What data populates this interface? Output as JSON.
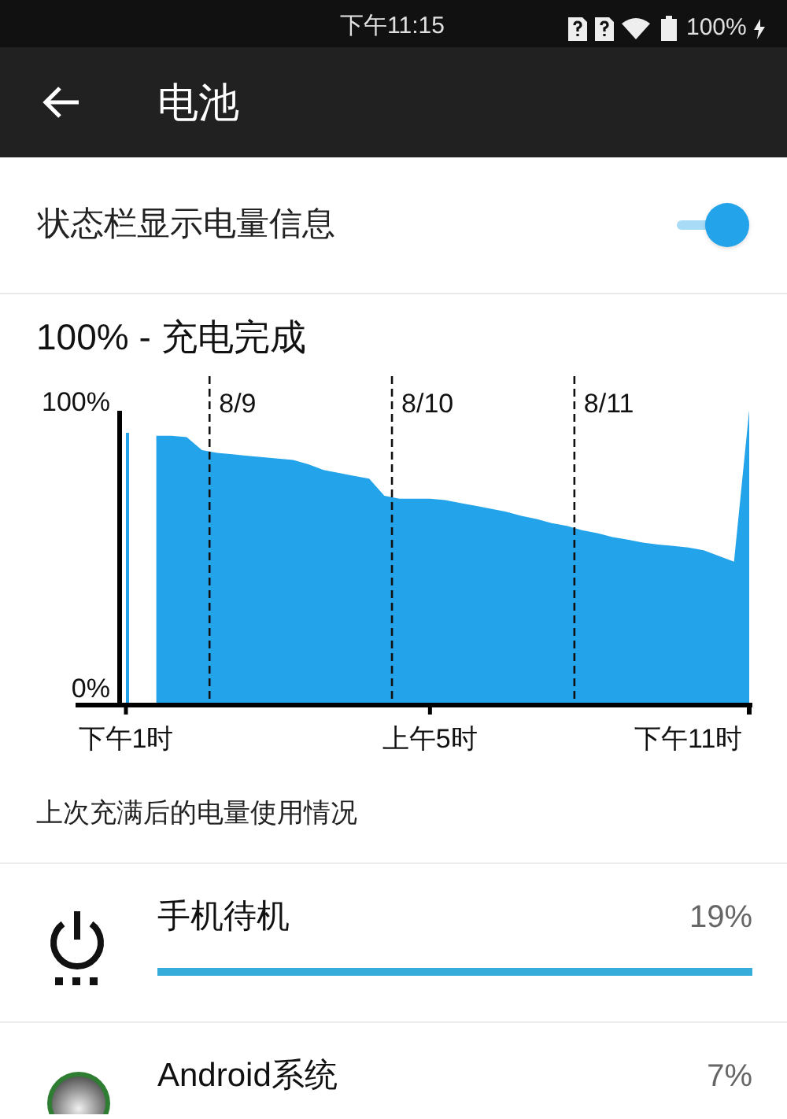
{
  "status_bar": {
    "time": "下午11:15",
    "battery": "100%",
    "charging": true
  },
  "app_bar": {
    "title": "电池"
  },
  "settings": [
    {
      "label": "状态栏显示电量信息",
      "on": true
    }
  ],
  "battery_status": "100% - 充电完成",
  "chart": {
    "chart_data": {
      "type": "area",
      "ylim": [
        0,
        100
      ],
      "categories": [
        "下午1时",
        null,
        null,
        null,
        null,
        null,
        null,
        null,
        null,
        null,
        null,
        null,
        null,
        null,
        null,
        null,
        null,
        null,
        null,
        null,
        "上午5时",
        null,
        null,
        null,
        null,
        null,
        null,
        null,
        null,
        null,
        null,
        null,
        null,
        null,
        null,
        null,
        null,
        "下午11时",
        null,
        null,
        null,
        null
      ],
      "series": [
        {
          "color": "#22a3ea",
          "values": [
            89,
            null,
            88,
            88,
            87.5,
            83,
            82,
            81.5,
            81,
            80.5,
            80,
            79.5,
            78,
            76,
            75,
            74,
            73,
            67,
            66,
            66,
            66,
            65.5,
            64.5,
            63.5,
            62.5,
            61.5,
            60,
            58.9,
            57.5,
            56.5,
            55,
            54,
            52.6,
            51.7,
            50.7,
            50,
            49.5,
            49,
            48,
            46,
            44,
            97
          ]
        }
      ],
      "yticks": [
        {
          "value": 0,
          "label": "0%"
        },
        {
          "value": 100,
          "label": "100%"
        }
      ],
      "annotations": [
        "8/9",
        "8/10",
        "8/11"
      ]
    }
  },
  "usage_heading": "上次充满后的电量使用情况",
  "usage": [
    {
      "kind": "standby",
      "name": "手机待机",
      "percent": "19%",
      "level": 1
    },
    {
      "kind": "android",
      "name": "Android系统",
      "percent": "7%"
    }
  ]
}
